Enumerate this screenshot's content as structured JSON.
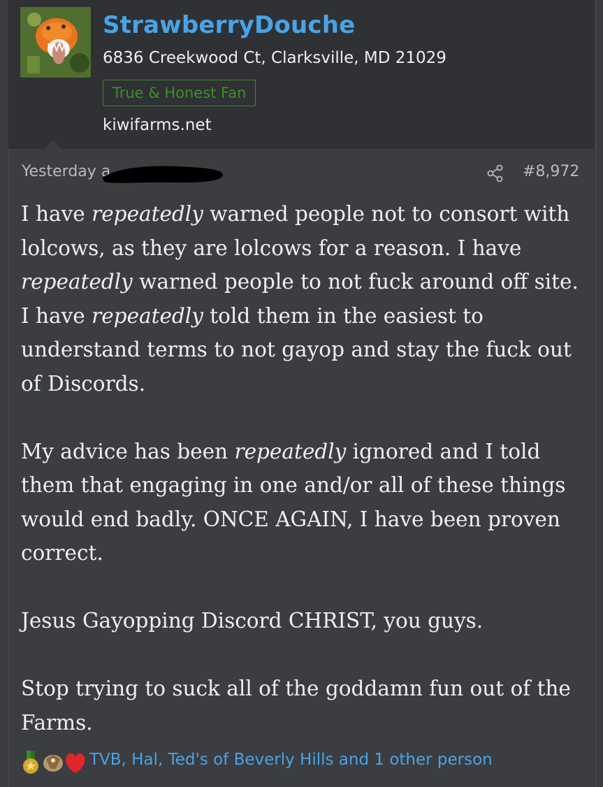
{
  "post": {
    "username": "StrawberryDouche",
    "address": "6836 Creekwood Ct, Clarksville, MD 21029",
    "badge": "True & Honest Fan",
    "site": "kiwifarms.net",
    "time_prefix": "Yesterday a",
    "post_number": "#8,972",
    "body": {
      "p1": {
        "s1": "I have ",
        "e1": "repeatedly",
        "s2": " warned people not to consort with lolcows, as they are lolcows for a reason. I have ",
        "e2": "repeatedly",
        "s3": " warned people to not fuck around off site. I have ",
        "e3": "repeatedly",
        "s4": " told them in the easiest to understand terms to not gayop and stay the fuck out of Discords."
      },
      "p2": {
        "s1": "My advice has been ",
        "e1": "repeatedly",
        "s2": " ignored and I told them that engaging in one and/or all of these things would end badly. ONCE AGAIN, I have been proven correct."
      },
      "p3": "Jesus Gayopping Discord CHRIST, you guys.",
      "p4": "Stop trying to suck all of the goddamn fun out of the Farms."
    },
    "reactions_text": "TVB, Hal, Ted's of Beverly Hills and 1 other person"
  },
  "colors": {
    "background": "#3b3d41",
    "header": "#2f3134",
    "username": "#4aa3e6",
    "badge": "#3d8f28",
    "link": "#4aa3e6"
  },
  "icons": [
    "avatar-image",
    "share-icon",
    "medal-reaction-icon",
    "eagle-reaction-icon",
    "heart-reaction-icon"
  ]
}
